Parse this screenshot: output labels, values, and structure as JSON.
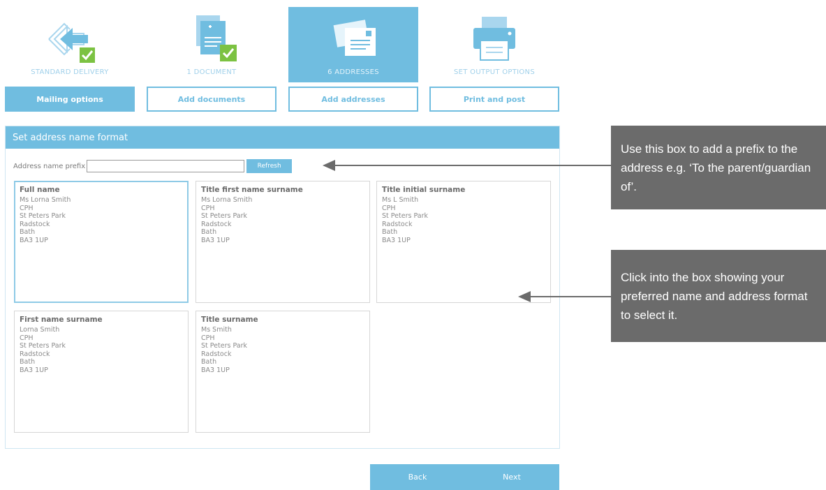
{
  "steps": [
    {
      "label": "STANDARD DELIVERY",
      "icon": "delivery-icon",
      "complete": true
    },
    {
      "label": "1 DOCUMENT",
      "icon": "document-icon",
      "complete": true
    },
    {
      "label": "6 ADDRESSES",
      "icon": "envelope-icon",
      "active": true
    },
    {
      "label": "SET OUTPUT OPTIONS",
      "icon": "printer-icon"
    }
  ],
  "tabs": [
    {
      "label": "Mailing options",
      "active": true
    },
    {
      "label": "Add documents"
    },
    {
      "label": "Add addresses"
    },
    {
      "label": "Print and post"
    }
  ],
  "panel": {
    "title": "Set address name format",
    "prefix_label": "Address name prefix",
    "prefix_value": "",
    "refresh_label": "Refresh"
  },
  "formats": [
    {
      "title": "Full name",
      "lines": [
        "Ms Lorna Smith",
        "CPH",
        "St Peters Park",
        "Radstock",
        "Bath",
        "BA3 1UP"
      ],
      "selected": true
    },
    {
      "title": "Title first name surname",
      "lines": [
        "Ms Lorna Smith",
        "CPH",
        "St Peters Park",
        "Radstock",
        "Bath",
        "BA3 1UP"
      ]
    },
    {
      "title": "Title initial surname",
      "lines": [
        "Ms L Smith",
        "CPH",
        "St Peters Park",
        "Radstock",
        "Bath",
        "BA3 1UP"
      ]
    },
    {
      "title": "First name surname",
      "lines": [
        "Lorna Smith",
        "CPH",
        "St Peters Park",
        "Radstock",
        "Bath",
        "BA3 1UP"
      ]
    },
    {
      "title": "Title surname",
      "lines": [
        "Ms Smith",
        "CPH",
        "St Peters Park",
        "Radstock",
        "Bath",
        "BA3 1UP"
      ]
    }
  ],
  "nav": {
    "back_label": "Back",
    "next_label": "Next"
  },
  "callouts": [
    {
      "text": "Use this box to add a prefix to the address e.g. ‘To the parent/guardian of’."
    },
    {
      "text": "Click into the box showing your preferred name and address format to select it."
    }
  ],
  "colors": {
    "accent": "#70bde0",
    "check": "#7cc242",
    "callout_bg": "#6b6b6b"
  }
}
